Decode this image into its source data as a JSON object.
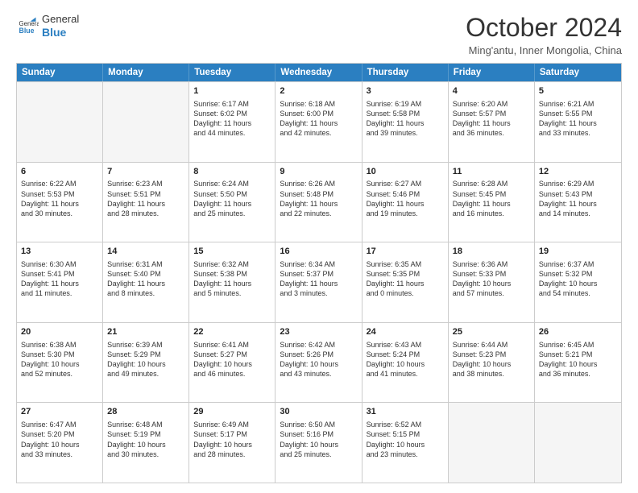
{
  "header": {
    "logo_line1": "General",
    "logo_line2": "Blue",
    "month_title": "October 2024",
    "location": "Ming'antu, Inner Mongolia, China"
  },
  "calendar": {
    "days_of_week": [
      "Sunday",
      "Monday",
      "Tuesday",
      "Wednesday",
      "Thursday",
      "Friday",
      "Saturday"
    ],
    "rows": [
      [
        {
          "day": "",
          "lines": [],
          "empty": true
        },
        {
          "day": "",
          "lines": [],
          "empty": true
        },
        {
          "day": "1",
          "lines": [
            "Sunrise: 6:17 AM",
            "Sunset: 6:02 PM",
            "Daylight: 11 hours",
            "and 44 minutes."
          ],
          "empty": false
        },
        {
          "day": "2",
          "lines": [
            "Sunrise: 6:18 AM",
            "Sunset: 6:00 PM",
            "Daylight: 11 hours",
            "and 42 minutes."
          ],
          "empty": false
        },
        {
          "day": "3",
          "lines": [
            "Sunrise: 6:19 AM",
            "Sunset: 5:58 PM",
            "Daylight: 11 hours",
            "and 39 minutes."
          ],
          "empty": false
        },
        {
          "day": "4",
          "lines": [
            "Sunrise: 6:20 AM",
            "Sunset: 5:57 PM",
            "Daylight: 11 hours",
            "and 36 minutes."
          ],
          "empty": false
        },
        {
          "day": "5",
          "lines": [
            "Sunrise: 6:21 AM",
            "Sunset: 5:55 PM",
            "Daylight: 11 hours",
            "and 33 minutes."
          ],
          "empty": false
        }
      ],
      [
        {
          "day": "6",
          "lines": [
            "Sunrise: 6:22 AM",
            "Sunset: 5:53 PM",
            "Daylight: 11 hours",
            "and 30 minutes."
          ],
          "empty": false
        },
        {
          "day": "7",
          "lines": [
            "Sunrise: 6:23 AM",
            "Sunset: 5:51 PM",
            "Daylight: 11 hours",
            "and 28 minutes."
          ],
          "empty": false
        },
        {
          "day": "8",
          "lines": [
            "Sunrise: 6:24 AM",
            "Sunset: 5:50 PM",
            "Daylight: 11 hours",
            "and 25 minutes."
          ],
          "empty": false
        },
        {
          "day": "9",
          "lines": [
            "Sunrise: 6:26 AM",
            "Sunset: 5:48 PM",
            "Daylight: 11 hours",
            "and 22 minutes."
          ],
          "empty": false
        },
        {
          "day": "10",
          "lines": [
            "Sunrise: 6:27 AM",
            "Sunset: 5:46 PM",
            "Daylight: 11 hours",
            "and 19 minutes."
          ],
          "empty": false
        },
        {
          "day": "11",
          "lines": [
            "Sunrise: 6:28 AM",
            "Sunset: 5:45 PM",
            "Daylight: 11 hours",
            "and 16 minutes."
          ],
          "empty": false
        },
        {
          "day": "12",
          "lines": [
            "Sunrise: 6:29 AM",
            "Sunset: 5:43 PM",
            "Daylight: 11 hours",
            "and 14 minutes."
          ],
          "empty": false
        }
      ],
      [
        {
          "day": "13",
          "lines": [
            "Sunrise: 6:30 AM",
            "Sunset: 5:41 PM",
            "Daylight: 11 hours",
            "and 11 minutes."
          ],
          "empty": false
        },
        {
          "day": "14",
          "lines": [
            "Sunrise: 6:31 AM",
            "Sunset: 5:40 PM",
            "Daylight: 11 hours",
            "and 8 minutes."
          ],
          "empty": false
        },
        {
          "day": "15",
          "lines": [
            "Sunrise: 6:32 AM",
            "Sunset: 5:38 PM",
            "Daylight: 11 hours",
            "and 5 minutes."
          ],
          "empty": false
        },
        {
          "day": "16",
          "lines": [
            "Sunrise: 6:34 AM",
            "Sunset: 5:37 PM",
            "Daylight: 11 hours",
            "and 3 minutes."
          ],
          "empty": false
        },
        {
          "day": "17",
          "lines": [
            "Sunrise: 6:35 AM",
            "Sunset: 5:35 PM",
            "Daylight: 11 hours",
            "and 0 minutes."
          ],
          "empty": false
        },
        {
          "day": "18",
          "lines": [
            "Sunrise: 6:36 AM",
            "Sunset: 5:33 PM",
            "Daylight: 10 hours",
            "and 57 minutes."
          ],
          "empty": false
        },
        {
          "day": "19",
          "lines": [
            "Sunrise: 6:37 AM",
            "Sunset: 5:32 PM",
            "Daylight: 10 hours",
            "and 54 minutes."
          ],
          "empty": false
        }
      ],
      [
        {
          "day": "20",
          "lines": [
            "Sunrise: 6:38 AM",
            "Sunset: 5:30 PM",
            "Daylight: 10 hours",
            "and 52 minutes."
          ],
          "empty": false
        },
        {
          "day": "21",
          "lines": [
            "Sunrise: 6:39 AM",
            "Sunset: 5:29 PM",
            "Daylight: 10 hours",
            "and 49 minutes."
          ],
          "empty": false
        },
        {
          "day": "22",
          "lines": [
            "Sunrise: 6:41 AM",
            "Sunset: 5:27 PM",
            "Daylight: 10 hours",
            "and 46 minutes."
          ],
          "empty": false
        },
        {
          "day": "23",
          "lines": [
            "Sunrise: 6:42 AM",
            "Sunset: 5:26 PM",
            "Daylight: 10 hours",
            "and 43 minutes."
          ],
          "empty": false
        },
        {
          "day": "24",
          "lines": [
            "Sunrise: 6:43 AM",
            "Sunset: 5:24 PM",
            "Daylight: 10 hours",
            "and 41 minutes."
          ],
          "empty": false
        },
        {
          "day": "25",
          "lines": [
            "Sunrise: 6:44 AM",
            "Sunset: 5:23 PM",
            "Daylight: 10 hours",
            "and 38 minutes."
          ],
          "empty": false
        },
        {
          "day": "26",
          "lines": [
            "Sunrise: 6:45 AM",
            "Sunset: 5:21 PM",
            "Daylight: 10 hours",
            "and 36 minutes."
          ],
          "empty": false
        }
      ],
      [
        {
          "day": "27",
          "lines": [
            "Sunrise: 6:47 AM",
            "Sunset: 5:20 PM",
            "Daylight: 10 hours",
            "and 33 minutes."
          ],
          "empty": false
        },
        {
          "day": "28",
          "lines": [
            "Sunrise: 6:48 AM",
            "Sunset: 5:19 PM",
            "Daylight: 10 hours",
            "and 30 minutes."
          ],
          "empty": false
        },
        {
          "day": "29",
          "lines": [
            "Sunrise: 6:49 AM",
            "Sunset: 5:17 PM",
            "Daylight: 10 hours",
            "and 28 minutes."
          ],
          "empty": false
        },
        {
          "day": "30",
          "lines": [
            "Sunrise: 6:50 AM",
            "Sunset: 5:16 PM",
            "Daylight: 10 hours",
            "and 25 minutes."
          ],
          "empty": false
        },
        {
          "day": "31",
          "lines": [
            "Sunrise: 6:52 AM",
            "Sunset: 5:15 PM",
            "Daylight: 10 hours",
            "and 23 minutes."
          ],
          "empty": false
        },
        {
          "day": "",
          "lines": [],
          "empty": true
        },
        {
          "day": "",
          "lines": [],
          "empty": true
        }
      ]
    ]
  }
}
